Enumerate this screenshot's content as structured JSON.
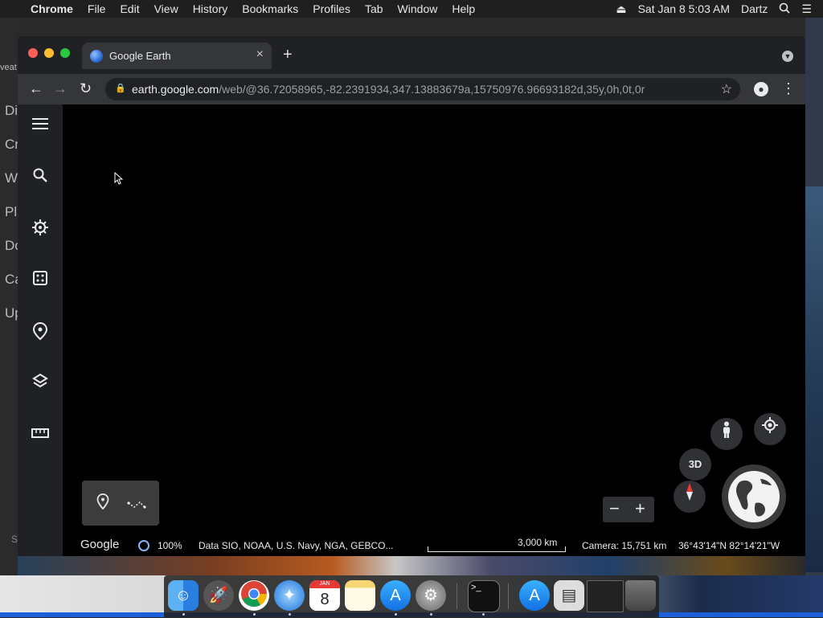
{
  "menubar": {
    "apple": "",
    "items": [
      "Chrome",
      "File",
      "Edit",
      "View",
      "History",
      "Bookmarks",
      "Profiles",
      "Tab",
      "Window",
      "Help"
    ],
    "datetime": "Sat Jan 8  5:03 AM",
    "user": "Dartz"
  },
  "background_left_labels": [
    "veat",
    "Di",
    "Cr",
    "W",
    "Pl",
    "Do",
    "Ca",
    "Up",
    "S"
  ],
  "tab": {
    "title": "Google Earth",
    "close": "×",
    "new": "+"
  },
  "toolbar": {
    "url_host": "earth.google.com",
    "url_path": "/web/@36.72058965,-82.2391934,347.13883679a,15750976.96693182d,35y,0h,0t,0r"
  },
  "earth": {
    "logo": "Google",
    "load_percent": "100%",
    "data_credits": "Data SIO, NOAA, U.S. Navy, NGA, GEBCO...",
    "scale_label": "3,000 km",
    "camera": "Camera: 15,751 km",
    "coordinates": "36°43'14\"N 82°14'21\"W",
    "btn_3d": "3D",
    "zoom_out": "−",
    "zoom_in": "+",
    "sidebar_icons": [
      "menu-icon",
      "search-icon",
      "voyager-icon",
      "feeling-lucky-icon",
      "projects-icon",
      "map-style-icon",
      "measure-icon"
    ]
  },
  "dock": {
    "apps": [
      "Finder",
      "Launchpad",
      "Google Chrome",
      "Safari",
      "Calendar",
      "Notes",
      "App Store",
      "System Preferences",
      "Terminal",
      "App Store",
      "Preview",
      "Window",
      "Trash"
    ],
    "calendar_month": "JAN",
    "calendar_day": "8"
  }
}
